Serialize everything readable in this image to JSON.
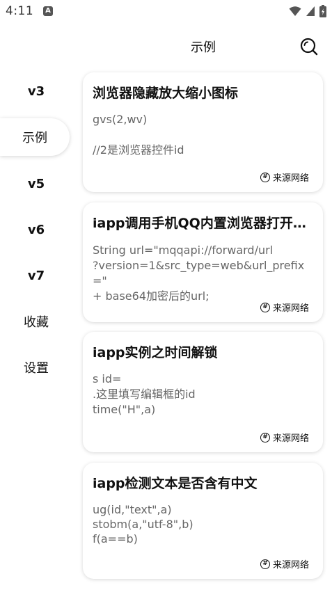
{
  "status": {
    "time": "4:11",
    "notification_badge": "A"
  },
  "header": {
    "title": "示例"
  },
  "sidebar": {
    "items": [
      {
        "label": "v3"
      },
      {
        "label": "示例",
        "active": true
      },
      {
        "label": "v5"
      },
      {
        "label": "v6"
      },
      {
        "label": "v7"
      },
      {
        "label": "收藏"
      },
      {
        "label": "设置"
      }
    ]
  },
  "cards": [
    {
      "title": "浏览器隐藏放大缩小图标",
      "body": "gvs(2,wv)\n\n//2是浏览器控件id",
      "source": "来源网络"
    },
    {
      "title": "iapp调用手机QQ内置浏览器打开链接",
      "body": "String url=\"mqqapi://forward/url\n?version=1&src_type=web&url_prefix=\"\n+ base64加密后的url;",
      "source": "来源网络"
    },
    {
      "title": "iapp实例之时间解锁",
      "body": "s id=\n.这里填写编辑框的id\ntime(\"H\",a)",
      "source": "来源网络"
    },
    {
      "title": "iapp检测文本是否含有中文",
      "body": "ug(id,\"text\",a)\nstobm(a,\"utf-8\",b)\nf(a==b)",
      "source": "来源网络"
    }
  ],
  "icons": {
    "search": "search-icon",
    "wifi": "wifi-icon",
    "signal": "signal-icon",
    "battery": "battery-icon",
    "source": "hash-circle-icon"
  }
}
